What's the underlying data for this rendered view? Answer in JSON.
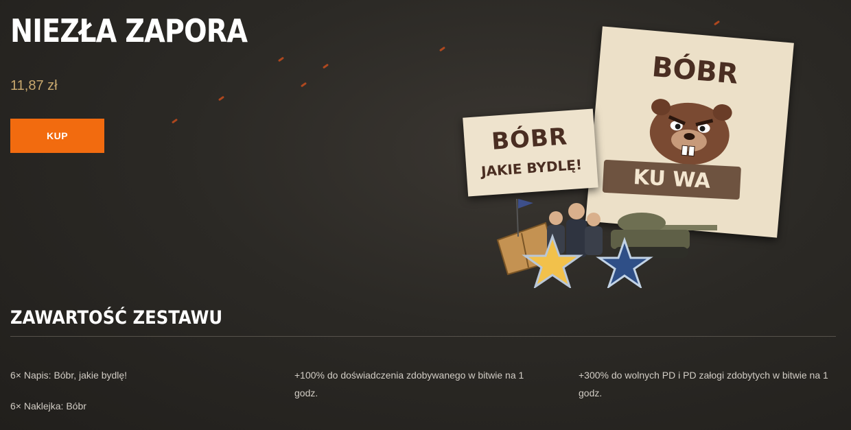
{
  "product": {
    "title": "NIEZŁA ZAPORA",
    "price": "11,87 zł",
    "buy_label": "KUP"
  },
  "illustration": {
    "inscription_top": "BÓBR",
    "inscription_bottom": "JAKIE BYDLĘ!",
    "sticker_top": "BÓBR",
    "sticker_bottom": "KU WA"
  },
  "contents": {
    "heading": "ZAWARTOŚĆ ZESTAWU",
    "items": [
      {
        "count": "6×",
        "type": "Napis:",
        "name": "Bóbr, jakie bydlę!"
      },
      {
        "count": "6×",
        "type": "Naklejka:",
        "name": "Bóbr"
      }
    ],
    "bonus_xp": "+100% do doświadczenia zdobywanego w bitwie na 1 godz.",
    "bonus_free_xp": "+300% do wolnych PD i PD załogi zdobytych w bitwie na 1 godz."
  },
  "colors": {
    "accent": "#f26b0f",
    "price": "#c8a86e",
    "background": "#2b2925"
  }
}
